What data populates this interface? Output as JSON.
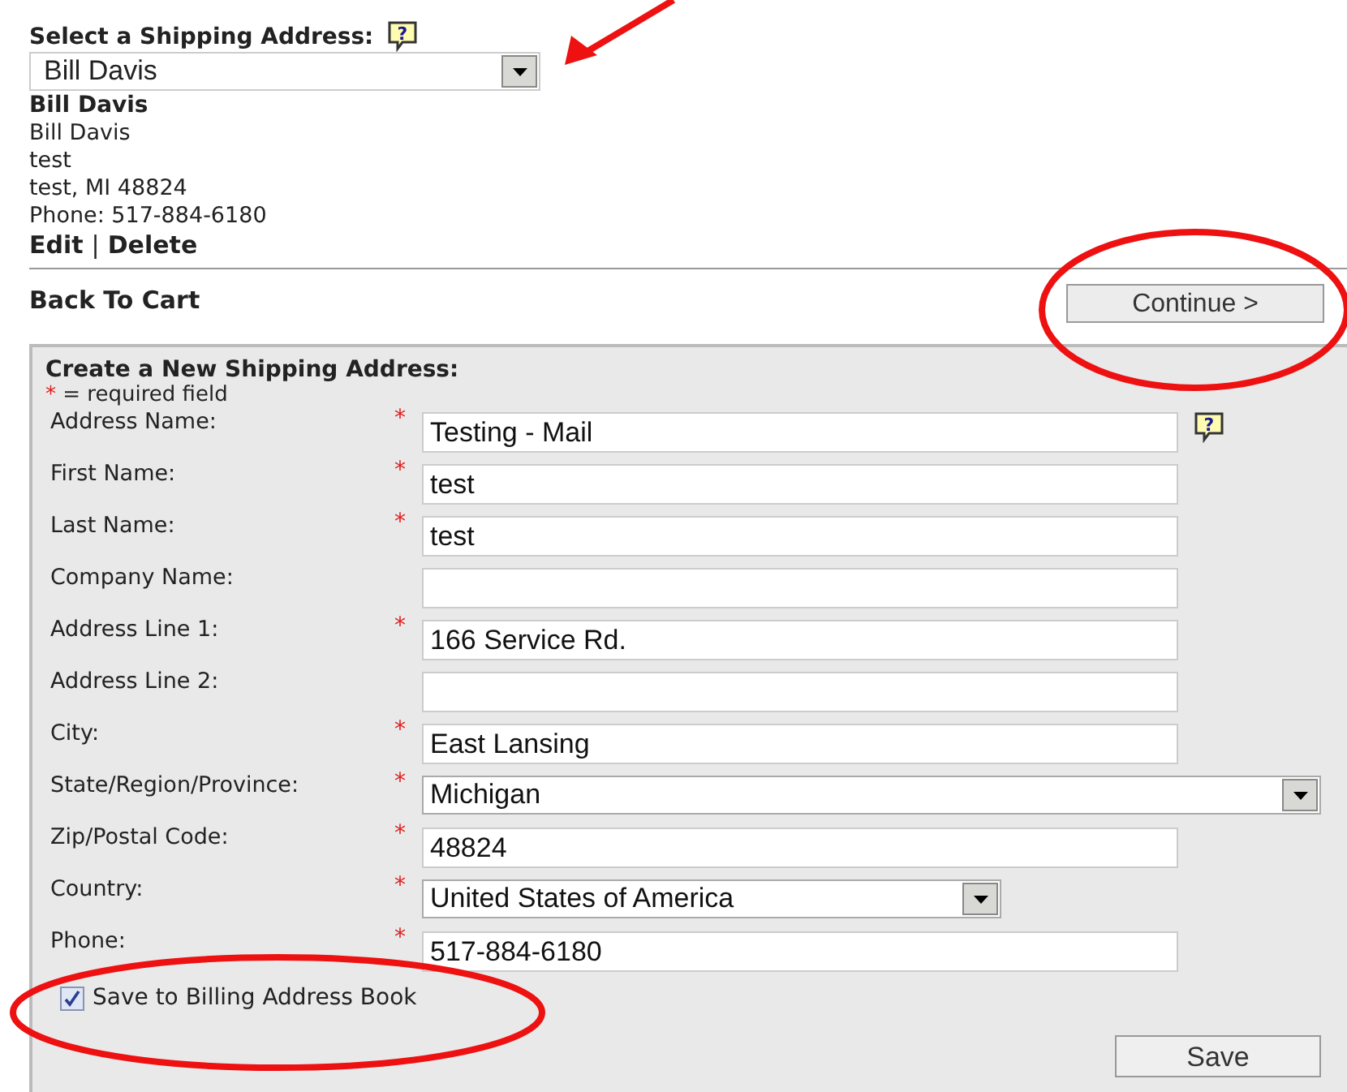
{
  "shipping_select": {
    "label": "Select a Shipping Address:",
    "help_icon": "?",
    "value": "Bill Davis"
  },
  "address_card": {
    "title": "Bill Davis",
    "lines": [
      "Bill Davis",
      "test",
      "test, MI 48824",
      "Phone: 517-884-6180"
    ],
    "links": [
      "Edit",
      "Delete"
    ],
    "separator": "|"
  },
  "back_link": "Back To Cart",
  "continue_button": "Continue >",
  "new_address_form": {
    "title": "Create a New Shipping Address:",
    "required_mark": "*",
    "required_note": "= required field",
    "fields": [
      {
        "label": "Address Name:",
        "kind": "text",
        "required": true,
        "help_icon": "?",
        "value": "Testing - Mail"
      },
      {
        "label": "First Name:",
        "kind": "text",
        "required": true,
        "value": "test"
      },
      {
        "label": "Last Name:",
        "kind": "text",
        "required": true,
        "value": "test"
      },
      {
        "label": "Company Name:",
        "kind": "text",
        "required": false
      },
      {
        "label": "Address Line 1:",
        "kind": "text",
        "required": true,
        "value": "166 Service Rd."
      },
      {
        "label": "Address Line 2:",
        "kind": "text",
        "required": false
      },
      {
        "label": "City:",
        "kind": "text",
        "required": true,
        "value": "East Lansing"
      },
      {
        "label": "State/Region/Province:",
        "kind": "wide_select",
        "required": true,
        "value": "Michigan"
      },
      {
        "label": "Zip/Postal Code:",
        "kind": "text",
        "required": true,
        "value": "48824"
      },
      {
        "label": "Country:",
        "kind": "select",
        "required": true,
        "value": "United States of America"
      },
      {
        "label": "Phone:",
        "kind": "text",
        "required": true,
        "value": "517-884-6180"
      }
    ],
    "save_to_billing": {
      "label": "Save to Billing Address Book",
      "checked": true
    },
    "save_button": "Save"
  }
}
